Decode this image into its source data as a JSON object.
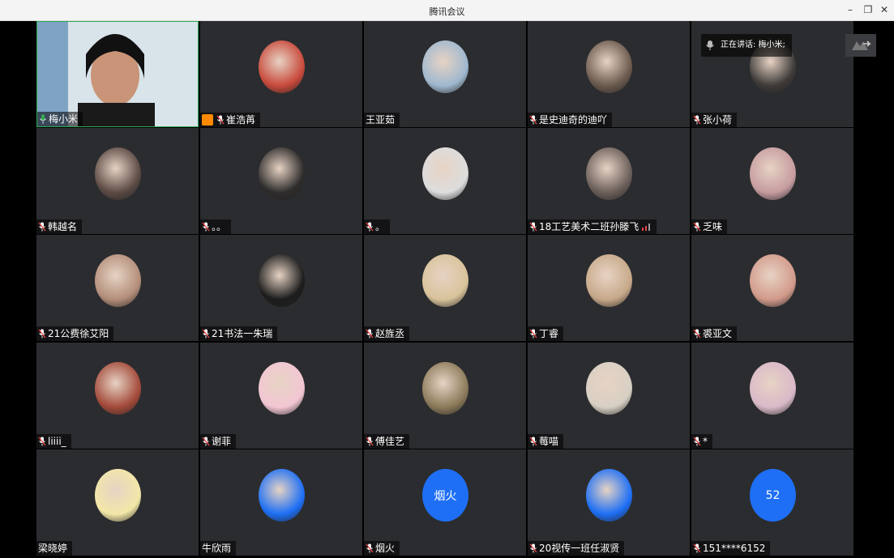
{
  "window": {
    "title": "腾讯会议",
    "controls": {
      "minimize": "–",
      "restore": "❐",
      "close": "✕"
    }
  },
  "speaking": {
    "label": "正在讲话: 梅小米;"
  },
  "participants": [
    {
      "name": "梅小米",
      "avatar": "video",
      "mic": "green"
    },
    {
      "name": "崔浩苒",
      "avatar": "photo",
      "host": true,
      "mic": "red"
    },
    {
      "name": "王亚茹",
      "avatar": "photo",
      "mic": "none"
    },
    {
      "name": "是史迪奇的迪吖",
      "avatar": "photo",
      "mic": "red"
    },
    {
      "name": "张小荷",
      "avatar": "photo",
      "mic": "red"
    },
    {
      "name": "韩越名",
      "avatar": "photo",
      "mic": "red"
    },
    {
      "name": "。。",
      "avatar": "photo",
      "mic": "red"
    },
    {
      "name": "。",
      "avatar": "photo",
      "mic": "red"
    },
    {
      "name": "18工艺美术二班孙滕飞",
      "avatar": "photo",
      "mic": "red",
      "signal": true
    },
    {
      "name": "乏味",
      "avatar": "photo",
      "mic": "red"
    },
    {
      "name": "21公费徐艾阳",
      "avatar": "photo",
      "mic": "red"
    },
    {
      "name": "21书法一朱瑞",
      "avatar": "photo",
      "mic": "red"
    },
    {
      "name": "赵旌丞",
      "avatar": "photo",
      "mic": "red"
    },
    {
      "name": "丁睿",
      "avatar": "photo",
      "mic": "red"
    },
    {
      "name": "裘亚文",
      "avatar": "photo",
      "mic": "red"
    },
    {
      "name": "liiii_",
      "avatar": "photo",
      "mic": "red"
    },
    {
      "name": "谢菲",
      "avatar": "photo",
      "mic": "red"
    },
    {
      "name": "傅佳艺",
      "avatar": "photo",
      "mic": "red"
    },
    {
      "name": "莓喵",
      "avatar": "photo",
      "mic": "red"
    },
    {
      "name": "*",
      "avatar": "photo",
      "mic": "red"
    },
    {
      "name": "梁晓婷",
      "avatar": "photo",
      "mic": "none"
    },
    {
      "name": "牛欣雨",
      "avatar": "photo",
      "mic": "none"
    },
    {
      "name": "烟火",
      "avatar": "text",
      "avatar_text": "烟火",
      "mic": "red"
    },
    {
      "name": "20视传一班任淑贤",
      "avatar": "photo",
      "mic": "red"
    },
    {
      "name": "151****6152",
      "avatar": "text",
      "avatar_text": "52",
      "mic": "red"
    }
  ],
  "colors": {
    "tile": "#2b2c2f",
    "active_border": "#2fa84f",
    "text_avatar": "#1e6ff5",
    "mic_red": "#e54545",
    "mic_green": "#2fa84f",
    "host": "#ff8a00"
  }
}
